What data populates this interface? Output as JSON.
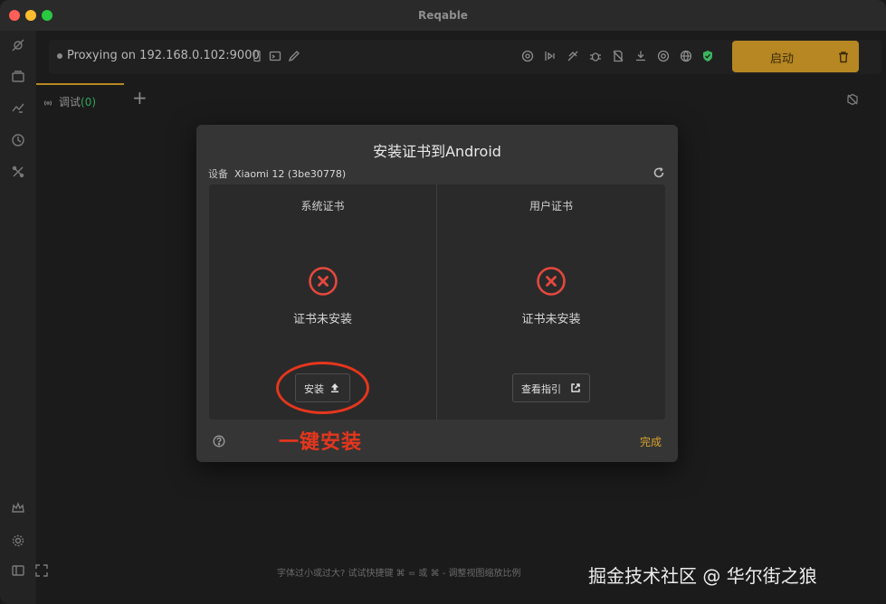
{
  "window": {
    "title": "Reqable"
  },
  "toolbar": {
    "proxy_status": "Proxying on 192.168.0.102:9000",
    "start_label": "启动",
    "accent_color": "#b68722"
  },
  "tabs": [
    {
      "label": "调试",
      "count": "(0)"
    }
  ],
  "dialog": {
    "title": "安装证书到Android",
    "device_label": "设备",
    "device_name": "Xiaomi 12 (3be30778)",
    "system_panel": {
      "title": "系统证书",
      "status": "证书未安装",
      "button_label": "安装",
      "button_icon": "upload-icon"
    },
    "user_panel": {
      "title": "用户证书",
      "status": "证书未安装",
      "button_label": "查看指引",
      "button_icon": "external-link-icon"
    },
    "done_label": "完成",
    "error_color": "#e5483e"
  },
  "annotation": {
    "text": "一键安装",
    "color": "#e5361d"
  },
  "statusbar": {
    "hint": "字体过小或过大? 试试快捷键 ⌘ = 或 ⌘ - 调整视图缩放比例"
  },
  "watermark": "掘金技术社区 @ 华尔街之狼"
}
